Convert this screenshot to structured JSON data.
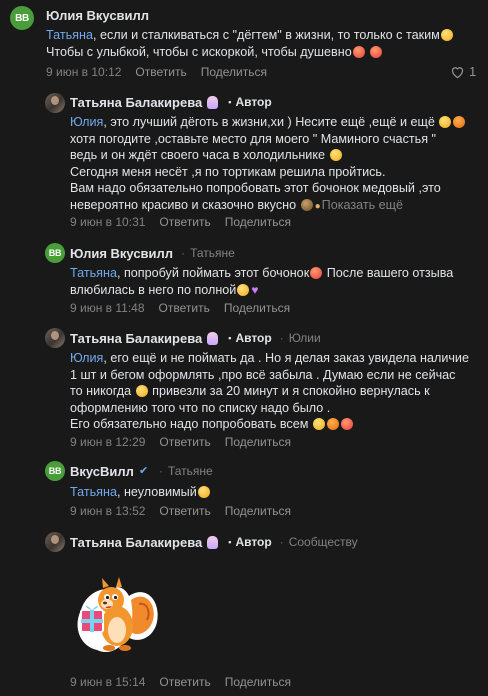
{
  "comments": [
    {
      "author": "Юлия Вкусвилл",
      "avatar_text": "ВВ",
      "mention": "Татьяна",
      "lines": [
        ", если и сталкиваться с \"дёгтем\" в жизни, то только с таким",
        "Чтобы с улыбкой, чтобы с искоркой, чтобы душевно"
      ],
      "time": "9 июн в 10:12",
      "reply_label": "Ответить",
      "share_label": "Поделиться",
      "likes": "1"
    },
    {
      "author": "Татьяна Балакирева",
      "author_badge": "Автор",
      "mention": "Юлия",
      "lines": [
        ", это лучший дёготь в жизни,хи ) Несите ещё ,ещё и ещё",
        "хотя погодите ,оставьте место для моего \" Маминого счастья \"",
        "ведь и он ждёт своего часа в холодильнике",
        "Сегодня меня несёт ,я по тортикам решила пройтись.",
        "Вам надо обязательно попробовать этот бочонок медовый ,это",
        "невероятно красиво и сказочно вкусно"
      ],
      "show_more": "Показать ещё",
      "time": "9 июн в 10:31",
      "reply_label": "Ответить",
      "share_label": "Поделиться"
    },
    {
      "author": "Юлия Вкусвилл",
      "avatar_text": "ВВ",
      "reply_to": "Татьяне",
      "mention": "Татьяна",
      "lines": [
        ", попробуй поймать этот бочонок",
        "После вашего отзыва",
        "влюбилась в него по полной"
      ],
      "time": "9 июн в 11:48",
      "reply_label": "Ответить",
      "share_label": "Поделиться"
    },
    {
      "author": "Татьяна Балакирева",
      "author_badge": "Автор",
      "reply_to": "Юлии",
      "mention": "Юлия",
      "lines": [
        ", его ещё и не поймать да . Но я делая заказ увидела наличие",
        "1 шт и бегом оформлять ,про всё забыла . Думаю если не сейчас",
        "то никогда",
        "привезли за 20 минут и я спокойно вернулась к",
        "оформлению того что по списку надо было .",
        "Его обязательно надо попробовать всем"
      ],
      "time": "9 июн в 12:29",
      "reply_label": "Ответить",
      "share_label": "Поделиться"
    },
    {
      "author": "ВкусВилл",
      "avatar_text": "ВВ",
      "reply_to": "Татьяне",
      "mention": "Татьяна",
      "lines": [
        ", неуловимый"
      ],
      "time": "9 июн в 13:52",
      "reply_label": "Ответить",
      "share_label": "Поделиться"
    },
    {
      "author": "Татьяна Балакирева",
      "author_badge": "Автор",
      "reply_to": "Сообществу",
      "time": "9 июн в 15:14",
      "reply_label": "Ответить",
      "share_label": "Поделиться"
    }
  ],
  "colors": {
    "background": "#19191a",
    "link": "#71aaeb",
    "meta": "#828282",
    "brand": "#4a9e3a"
  },
  "icons": {
    "like": "heart-icon",
    "verified": "verified-check-icon",
    "sticker": "squirrel-gift-sticker"
  }
}
